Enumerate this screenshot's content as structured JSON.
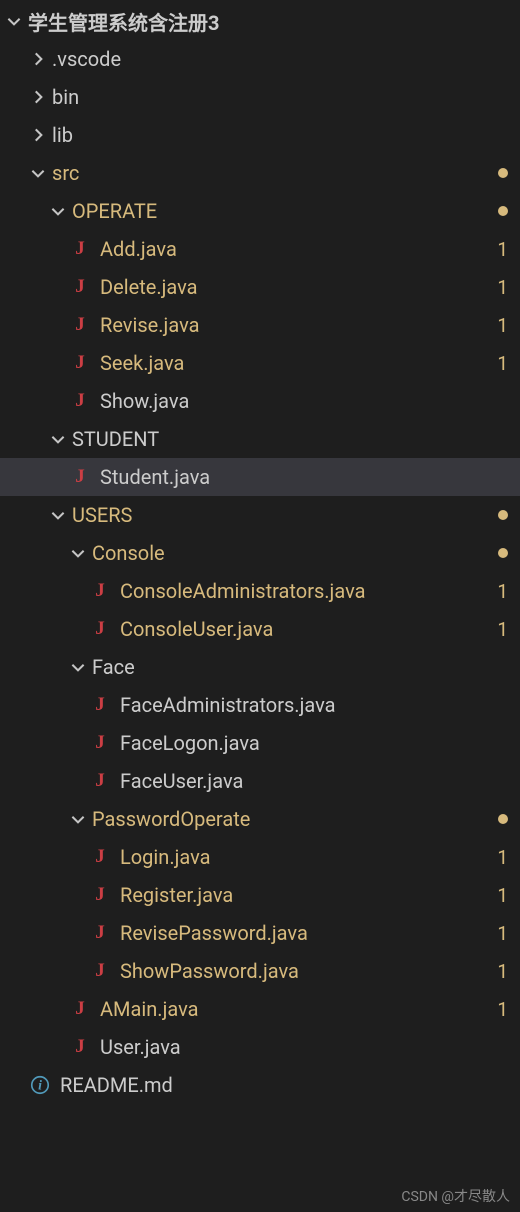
{
  "root": {
    "label": "学生管理系统含注册3",
    "expanded": true
  },
  "tree": [
    {
      "type": "folder",
      "label": ".vscode",
      "expanded": false,
      "depth": 1,
      "status": "none"
    },
    {
      "type": "folder",
      "label": "bin",
      "expanded": false,
      "depth": 1,
      "status": "none"
    },
    {
      "type": "folder",
      "label": "lib",
      "expanded": false,
      "depth": 1,
      "status": "none"
    },
    {
      "type": "folder",
      "label": "src",
      "expanded": true,
      "depth": 1,
      "status": "dot"
    },
    {
      "type": "folder",
      "label": "OPERATE",
      "expanded": true,
      "depth": 2,
      "status": "dot"
    },
    {
      "type": "java",
      "label": "Add.java",
      "depth": 3,
      "status": "num",
      "badge": "1"
    },
    {
      "type": "java",
      "label": "Delete.java",
      "depth": 3,
      "status": "num",
      "badge": "1"
    },
    {
      "type": "java",
      "label": "Revise.java",
      "depth": 3,
      "status": "num",
      "badge": "1"
    },
    {
      "type": "java",
      "label": "Seek.java",
      "depth": 3,
      "status": "num",
      "badge": "1"
    },
    {
      "type": "java",
      "label": "Show.java",
      "depth": 3,
      "status": "none"
    },
    {
      "type": "folder",
      "label": "STUDENT",
      "expanded": true,
      "depth": 2,
      "status": "none"
    },
    {
      "type": "java",
      "label": "Student.java",
      "depth": 3,
      "status": "none",
      "selected": true
    },
    {
      "type": "folder",
      "label": "USERS",
      "expanded": true,
      "depth": 2,
      "status": "dot"
    },
    {
      "type": "folder",
      "label": "Console",
      "expanded": true,
      "depth": 3,
      "status": "dot"
    },
    {
      "type": "java",
      "label": "ConsoleAdministrators.java",
      "depth": 4,
      "status": "num",
      "badge": "1"
    },
    {
      "type": "java",
      "label": "ConsoleUser.java",
      "depth": 4,
      "status": "num",
      "badge": "1"
    },
    {
      "type": "folder",
      "label": "Face",
      "expanded": true,
      "depth": 3,
      "status": "none"
    },
    {
      "type": "java",
      "label": "FaceAdministrators.java",
      "depth": 4,
      "status": "none"
    },
    {
      "type": "java",
      "label": "FaceLogon.java",
      "depth": 4,
      "status": "none"
    },
    {
      "type": "java",
      "label": "FaceUser.java",
      "depth": 4,
      "status": "none"
    },
    {
      "type": "folder",
      "label": "PasswordOperate",
      "expanded": true,
      "depth": 3,
      "status": "dot"
    },
    {
      "type": "java",
      "label": "Login.java",
      "depth": 4,
      "status": "num",
      "badge": "1"
    },
    {
      "type": "java",
      "label": "Register.java",
      "depth": 4,
      "status": "num",
      "badge": "1"
    },
    {
      "type": "java",
      "label": "RevisePassword.java",
      "depth": 4,
      "status": "num",
      "badge": "1"
    },
    {
      "type": "java",
      "label": "ShowPassword.java",
      "depth": 4,
      "status": "num",
      "badge": "1"
    },
    {
      "type": "java",
      "label": "AMain.java",
      "depth": 3,
      "status": "num",
      "badge": "1"
    },
    {
      "type": "java",
      "label": "User.java",
      "depth": 3,
      "status": "none"
    },
    {
      "type": "readme",
      "label": "README.md",
      "depth": 1,
      "status": "none"
    }
  ],
  "watermark": "CSDN @才尽散人"
}
